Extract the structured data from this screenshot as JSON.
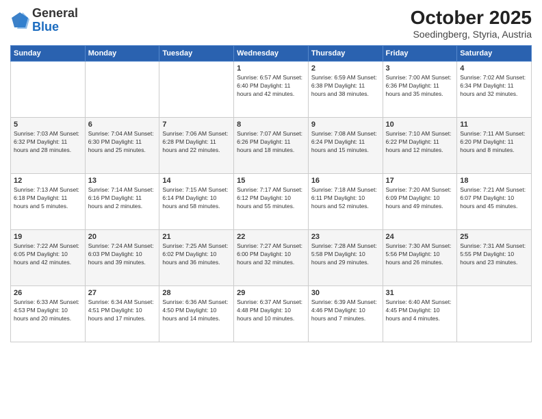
{
  "header": {
    "logo": {
      "general": "General",
      "blue": "Blue"
    },
    "month": "October 2025",
    "location": "Soedingberg, Styria, Austria"
  },
  "weekdays": [
    "Sunday",
    "Monday",
    "Tuesday",
    "Wednesday",
    "Thursday",
    "Friday",
    "Saturday"
  ],
  "weeks": [
    [
      {
        "day": "",
        "info": ""
      },
      {
        "day": "",
        "info": ""
      },
      {
        "day": "",
        "info": ""
      },
      {
        "day": "1",
        "info": "Sunrise: 6:57 AM\nSunset: 6:40 PM\nDaylight: 11 hours\nand 42 minutes."
      },
      {
        "day": "2",
        "info": "Sunrise: 6:59 AM\nSunset: 6:38 PM\nDaylight: 11 hours\nand 38 minutes."
      },
      {
        "day": "3",
        "info": "Sunrise: 7:00 AM\nSunset: 6:36 PM\nDaylight: 11 hours\nand 35 minutes."
      },
      {
        "day": "4",
        "info": "Sunrise: 7:02 AM\nSunset: 6:34 PM\nDaylight: 11 hours\nand 32 minutes."
      }
    ],
    [
      {
        "day": "5",
        "info": "Sunrise: 7:03 AM\nSunset: 6:32 PM\nDaylight: 11 hours\nand 28 minutes."
      },
      {
        "day": "6",
        "info": "Sunrise: 7:04 AM\nSunset: 6:30 PM\nDaylight: 11 hours\nand 25 minutes."
      },
      {
        "day": "7",
        "info": "Sunrise: 7:06 AM\nSunset: 6:28 PM\nDaylight: 11 hours\nand 22 minutes."
      },
      {
        "day": "8",
        "info": "Sunrise: 7:07 AM\nSunset: 6:26 PM\nDaylight: 11 hours\nand 18 minutes."
      },
      {
        "day": "9",
        "info": "Sunrise: 7:08 AM\nSunset: 6:24 PM\nDaylight: 11 hours\nand 15 minutes."
      },
      {
        "day": "10",
        "info": "Sunrise: 7:10 AM\nSunset: 6:22 PM\nDaylight: 11 hours\nand 12 minutes."
      },
      {
        "day": "11",
        "info": "Sunrise: 7:11 AM\nSunset: 6:20 PM\nDaylight: 11 hours\nand 8 minutes."
      }
    ],
    [
      {
        "day": "12",
        "info": "Sunrise: 7:13 AM\nSunset: 6:18 PM\nDaylight: 11 hours\nand 5 minutes."
      },
      {
        "day": "13",
        "info": "Sunrise: 7:14 AM\nSunset: 6:16 PM\nDaylight: 11 hours\nand 2 minutes."
      },
      {
        "day": "14",
        "info": "Sunrise: 7:15 AM\nSunset: 6:14 PM\nDaylight: 10 hours\nand 58 minutes."
      },
      {
        "day": "15",
        "info": "Sunrise: 7:17 AM\nSunset: 6:12 PM\nDaylight: 10 hours\nand 55 minutes."
      },
      {
        "day": "16",
        "info": "Sunrise: 7:18 AM\nSunset: 6:11 PM\nDaylight: 10 hours\nand 52 minutes."
      },
      {
        "day": "17",
        "info": "Sunrise: 7:20 AM\nSunset: 6:09 PM\nDaylight: 10 hours\nand 49 minutes."
      },
      {
        "day": "18",
        "info": "Sunrise: 7:21 AM\nSunset: 6:07 PM\nDaylight: 10 hours\nand 45 minutes."
      }
    ],
    [
      {
        "day": "19",
        "info": "Sunrise: 7:22 AM\nSunset: 6:05 PM\nDaylight: 10 hours\nand 42 minutes."
      },
      {
        "day": "20",
        "info": "Sunrise: 7:24 AM\nSunset: 6:03 PM\nDaylight: 10 hours\nand 39 minutes."
      },
      {
        "day": "21",
        "info": "Sunrise: 7:25 AM\nSunset: 6:02 PM\nDaylight: 10 hours\nand 36 minutes."
      },
      {
        "day": "22",
        "info": "Sunrise: 7:27 AM\nSunset: 6:00 PM\nDaylight: 10 hours\nand 32 minutes."
      },
      {
        "day": "23",
        "info": "Sunrise: 7:28 AM\nSunset: 5:58 PM\nDaylight: 10 hours\nand 29 minutes."
      },
      {
        "day": "24",
        "info": "Sunrise: 7:30 AM\nSunset: 5:56 PM\nDaylight: 10 hours\nand 26 minutes."
      },
      {
        "day": "25",
        "info": "Sunrise: 7:31 AM\nSunset: 5:55 PM\nDaylight: 10 hours\nand 23 minutes."
      }
    ],
    [
      {
        "day": "26",
        "info": "Sunrise: 6:33 AM\nSunset: 4:53 PM\nDaylight: 10 hours\nand 20 minutes."
      },
      {
        "day": "27",
        "info": "Sunrise: 6:34 AM\nSunset: 4:51 PM\nDaylight: 10 hours\nand 17 minutes."
      },
      {
        "day": "28",
        "info": "Sunrise: 6:36 AM\nSunset: 4:50 PM\nDaylight: 10 hours\nand 14 minutes."
      },
      {
        "day": "29",
        "info": "Sunrise: 6:37 AM\nSunset: 4:48 PM\nDaylight: 10 hours\nand 10 minutes."
      },
      {
        "day": "30",
        "info": "Sunrise: 6:39 AM\nSunset: 4:46 PM\nDaylight: 10 hours\nand 7 minutes."
      },
      {
        "day": "31",
        "info": "Sunrise: 6:40 AM\nSunset: 4:45 PM\nDaylight: 10 hours\nand 4 minutes."
      },
      {
        "day": "",
        "info": ""
      }
    ]
  ]
}
